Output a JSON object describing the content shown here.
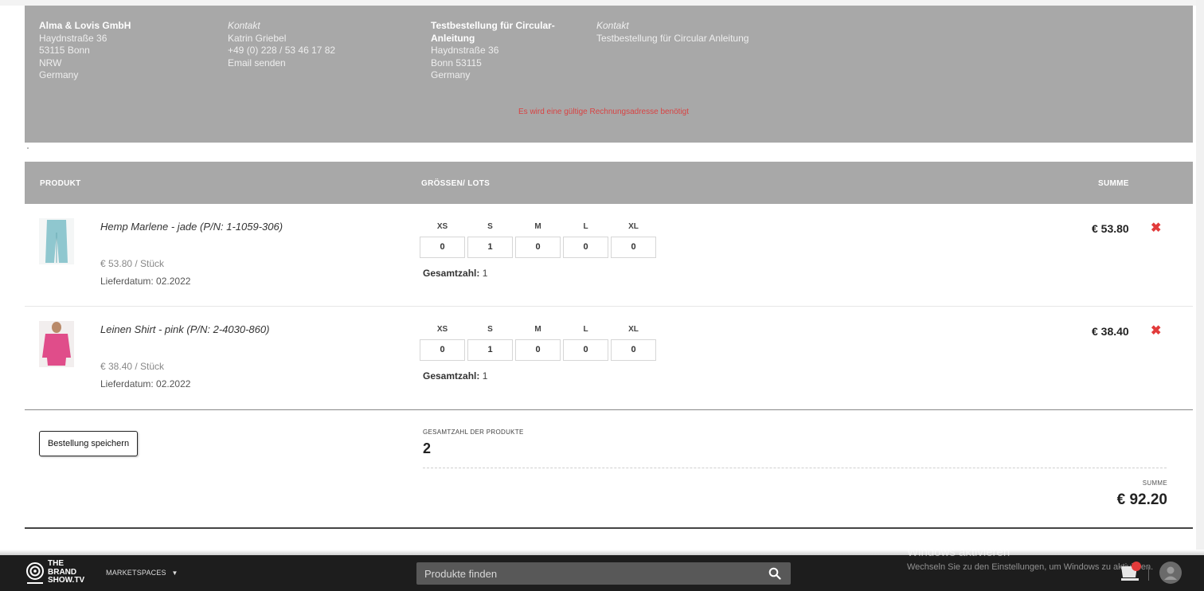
{
  "seller": {
    "name": "Alma & Lovis GmbH",
    "street": "Haydnstraße 36",
    "city": "53115 Bonn",
    "region": "NRW",
    "country": "Germany"
  },
  "seller_contact": {
    "label": "Kontakt",
    "name": "Katrin Griebel",
    "phone": "+49 (0) 228 / 53 46 17 82",
    "email_link": "Email senden"
  },
  "buyer": {
    "name_line1": "Testbestellung für Circular-",
    "name_line2": "Anleitung",
    "street": "Haydnstraße 36",
    "city": "Bonn 53115",
    "country": "Germany"
  },
  "buyer_contact": {
    "label": "Kontakt",
    "value": "Testbestellung für Circular Anleitung"
  },
  "address_error": "Es wird eine gültige Rechnungsadresse benötigt",
  "table": {
    "col_product": "PRODUKT",
    "col_sizes": "GRÖSSEN/ LOTS",
    "col_sum": "SUMME"
  },
  "sizes": [
    "XS",
    "S",
    "M",
    "L",
    "XL"
  ],
  "products": [
    {
      "name": "Hemp Marlene - jade (P/N: 1-1059-306)",
      "unit_price": "€ 53.80 / Stück",
      "delivery": "Lieferdatum: 02.2022",
      "qty": [
        "0",
        "1",
        "0",
        "0",
        "0"
      ],
      "total_label": "Gesamtzahl:",
      "total_value": "1",
      "sum": "€ 53.80",
      "thumb_color": "#8fc7cf"
    },
    {
      "name": "Leinen Shirt - pink (P/N: 2-4030-860)",
      "unit_price": "€ 38.40 / Stück",
      "delivery": "Lieferdatum: 02.2022",
      "qty": [
        "0",
        "1",
        "0",
        "0",
        "0"
      ],
      "total_label": "Gesamtzahl:",
      "total_value": "1",
      "sum": "€ 38.40",
      "thumb_color": "#e04d8a"
    }
  ],
  "footer": {
    "save_button": "Bestellung speichern",
    "total_products_label": "GESAMTZAHL DER PRODUKTE",
    "total_products_value": "2",
    "sum_label": "SUMME",
    "sum_value": "€ 92.20"
  },
  "bottom_bar": {
    "logo_line1": "THE",
    "logo_line2": "BRAND",
    "logo_line3": "SHOW.TV",
    "marketspaces": "MARKETSPACES",
    "search_placeholder": "Produkte finden",
    "win_title": "Windows aktivieren",
    "win_sub": "Wechseln Sie zu den Einstellungen, um Windows zu aktivieren."
  },
  "colors": {
    "panel_gray": "#a8a8a8",
    "delete_red": "#e23b3b",
    "bar_dark": "#1d1d1d"
  },
  "icons": [
    "close-icon",
    "search-icon",
    "chevron-down-icon",
    "cart-icon",
    "user-icon",
    "logo-icon"
  ]
}
